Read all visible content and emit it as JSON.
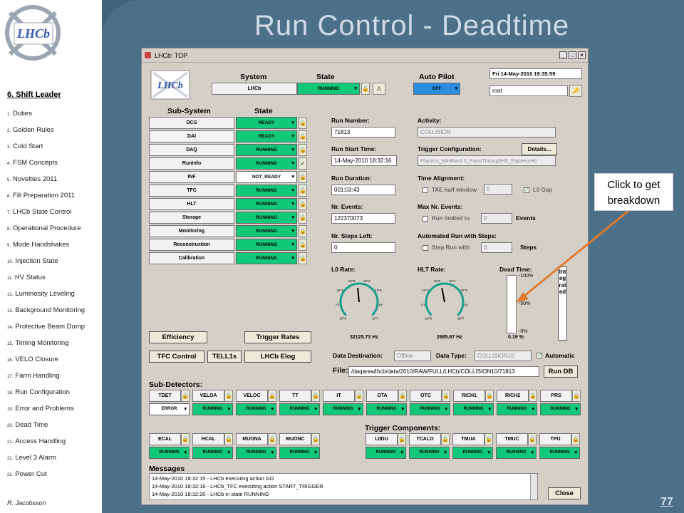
{
  "slide": {
    "title": "Run Control - Deadtime",
    "page_number": "77",
    "author": "R. Jacobsson"
  },
  "sidebar": {
    "heading": "6. Shift Leader",
    "items": [
      {
        "n": "1.",
        "label": "Duties"
      },
      {
        "n": "2.",
        "label": "Golden Rules"
      },
      {
        "n": "3.",
        "label": "Cold Start"
      },
      {
        "n": "4.",
        "label": "FSM Concepts"
      },
      {
        "n": "5.",
        "label": "Novelties 2011"
      },
      {
        "n": "6.",
        "label": "Fill Preparation 2011"
      },
      {
        "n": "7.",
        "label": "LHCb State Control"
      },
      {
        "n": "8.",
        "label": "Operational Procedure"
      },
      {
        "n": "9.",
        "label": "Mode Handshakes"
      },
      {
        "n": "10.",
        "label": "Injection State"
      },
      {
        "n": "11.",
        "label": "HV Status"
      },
      {
        "n": "12.",
        "label": "Luminosity Leveling"
      },
      {
        "n": "13.",
        "label": "Background Monitoring"
      },
      {
        "n": "14.",
        "label": "Protective Beam Dump"
      },
      {
        "n": "15.",
        "label": "Timing Monitoring"
      },
      {
        "n": "16.",
        "label": "VELO Closure"
      },
      {
        "n": "17.",
        "label": "Farm Handling"
      },
      {
        "n": "18.",
        "label": "Run Configuration"
      },
      {
        "n": "19.",
        "label": "Error and Problems"
      },
      {
        "n": "20.",
        "label": "Dead Time"
      },
      {
        "n": "21.",
        "label": "Access Handling"
      },
      {
        "n": "22.",
        "label": "Level 3 Alarm"
      },
      {
        "n": "22.",
        "label": "Power Cut"
      }
    ]
  },
  "callout": {
    "text": "Click to get breakdown"
  },
  "window": {
    "title": "LHCb: TOP",
    "logo_text": "LHCb",
    "top": {
      "system_label": "System",
      "state_label": "State",
      "autopilot_label": "Auto Pilot",
      "system": "LHCb",
      "state": "RUNNING",
      "autopilot": "OFF",
      "datetime": "Fri  14-May-2010     19:35:59",
      "user": "root"
    },
    "subsystem_header": "Sub-System",
    "state_header": "State",
    "subsystems": [
      {
        "name": "DCS",
        "state": "READY"
      },
      {
        "name": "DAI",
        "state": "READY"
      },
      {
        "name": "DAQ",
        "state": "RUNNING"
      },
      {
        "name": "RunInfo",
        "state": "RUNNING"
      },
      {
        "name": "INF",
        "state": "NOT_READY"
      },
      {
        "name": "TFC",
        "state": "RUNNING"
      },
      {
        "name": "HLT",
        "state": "RUNNING"
      },
      {
        "name": "Storage",
        "state": "RUNNING"
      },
      {
        "name": "Monitoring",
        "state": "RUNNING"
      },
      {
        "name": "Reconstruction",
        "state": "RUNNING"
      },
      {
        "name": "Calibration",
        "state": "RUNNING"
      }
    ],
    "run": {
      "run_number_label": "Run Number:",
      "run_number": "71813",
      "start_label": "Run Start Time:",
      "start": "14-May-2010 18:32:16",
      "duration_label": "Run Duration:",
      "duration": "001:03:43",
      "events_label": "Nr. Events:",
      "events": "122370073",
      "steps_label": "Nr. Steps Left:",
      "steps": "0"
    },
    "activity": {
      "activity_label": "Activity:",
      "activity": "COLLISION",
      "trigger_label": "Trigger Configuration:",
      "details": "Details...",
      "trigger": "Physics_MinBiasL0_PassThroughHlt_ExpressHlt",
      "time_align_label": "Time Alignment:",
      "tae_label": "TAE half window",
      "tae_value": "0",
      "l0gap_label": "L0 Gap",
      "max_events_label": "Max Nr. Events:",
      "run_limited_label": "Run limited to",
      "run_limited_value": "0",
      "events_unit": "Events",
      "auto_label": "Automated Run with Steps:",
      "step_label": "Step Run with",
      "step_value": "0",
      "steps_unit": "Steps"
    },
    "rates": {
      "l0_label": "L0 Rate:",
      "l0_value": "32125.73 Hz",
      "l0_fraction": 0.48,
      "hlt_label": "HLT Rate:",
      "hlt_value": "2985.67 Hz",
      "hlt_fraction": 0.46,
      "dead_label": "Dead Time:",
      "dead_value": "0.19 %",
      "dead_ticks": [
        "-100%",
        "-50%",
        "-0%"
      ],
      "integrated": "Integrated",
      "ticks": [
        "10",
        "10",
        "10",
        "10",
        "10",
        "10",
        "10",
        "10"
      ],
      "tick_exps": [
        "0",
        "1",
        "2",
        "3",
        "4",
        "5",
        "6",
        "7"
      ]
    },
    "buttons": {
      "efficiency": "Efficiency",
      "trigger_rates": "Trigger Rates",
      "tfc_control": "TFC Control",
      "tell1s": "TELL1s",
      "elog": "LHCb Elog",
      "run_db": "Run DB",
      "close": "Close"
    },
    "data": {
      "destination_label": "Data Destination:",
      "destination": "Offline",
      "type_label": "Data Type:",
      "type": "COLLISION10",
      "automatic_label": "Automatic",
      "file_label": "File:",
      "file": "/daqarea/lhcb/data/2010/RAW/FULL/LHCb/COLLISION10/71813"
    },
    "subdetectors_label": "Sub-Detectors:",
    "subdetectors_row1": [
      {
        "name": "TDET",
        "state": "ERROR"
      },
      {
        "name": "VELOA",
        "state": "RUNNING"
      },
      {
        "name": "VELOC",
        "state": "RUNNING"
      },
      {
        "name": "TT",
        "state": "RUNNING"
      },
      {
        "name": "IT",
        "state": "RUNNING"
      },
      {
        "name": "OTA",
        "state": "RUNNING"
      },
      {
        "name": "OTC",
        "state": "RUNNING"
      },
      {
        "name": "RICH1",
        "state": "RUNNING"
      },
      {
        "name": "RICH2",
        "state": "RUNNING"
      },
      {
        "name": "PRS",
        "state": "RUNNING"
      }
    ],
    "subdetectors_row2": [
      {
        "name": "ECAL",
        "state": "RUNNING"
      },
      {
        "name": "HCAL",
        "state": "RUNNING"
      },
      {
        "name": "MUONA",
        "state": "RUNNING"
      },
      {
        "name": "MUONC",
        "state": "RUNNING"
      }
    ],
    "trigger_components_label": "Trigger Components:",
    "trigger_components": [
      {
        "name": "L0DU",
        "state": "RUNNING"
      },
      {
        "name": "TCALO",
        "state": "RUNNING"
      },
      {
        "name": "TMUA",
        "state": "RUNNING"
      },
      {
        "name": "TMUC",
        "state": "RUNNING"
      },
      {
        "name": "TPU",
        "state": "RUNNING"
      }
    ],
    "messages_label": "Messages",
    "messages": [
      "14-May-2010 18:32:15 - LHCb executing action GO",
      "14-May-2010 18:32:16 - LHCb_TFC executing action START_TRIGGER",
      "14-May-2010 18:32:20 - LHCb in state RUNNING"
    ]
  }
}
